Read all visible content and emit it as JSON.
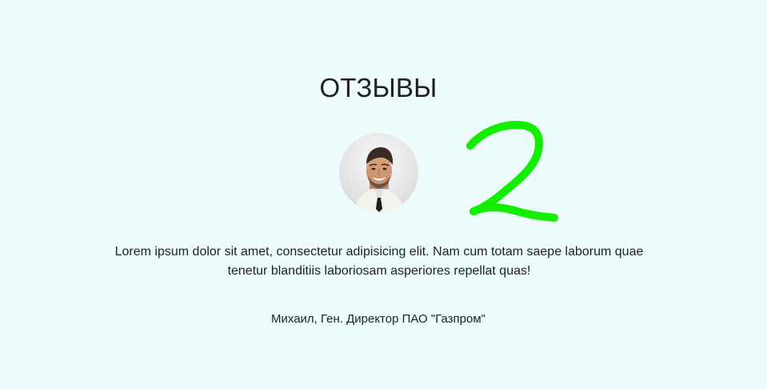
{
  "reviews": {
    "title": "ОТЗЫВЫ",
    "avatar_icon": "person-portrait-icon",
    "annotation_icon": "handwritten-number-two-icon",
    "annotation_color": "#13ee00",
    "quote": "Lorem ipsum dolor sit amet, consectetur adipisicing elit. Nam cum totam saepe laborum quae tenetur blanditiis laboriosam asperiores repellat quas!",
    "author": "Михаил, Ген. Директор ПАО \"Газпром\""
  }
}
